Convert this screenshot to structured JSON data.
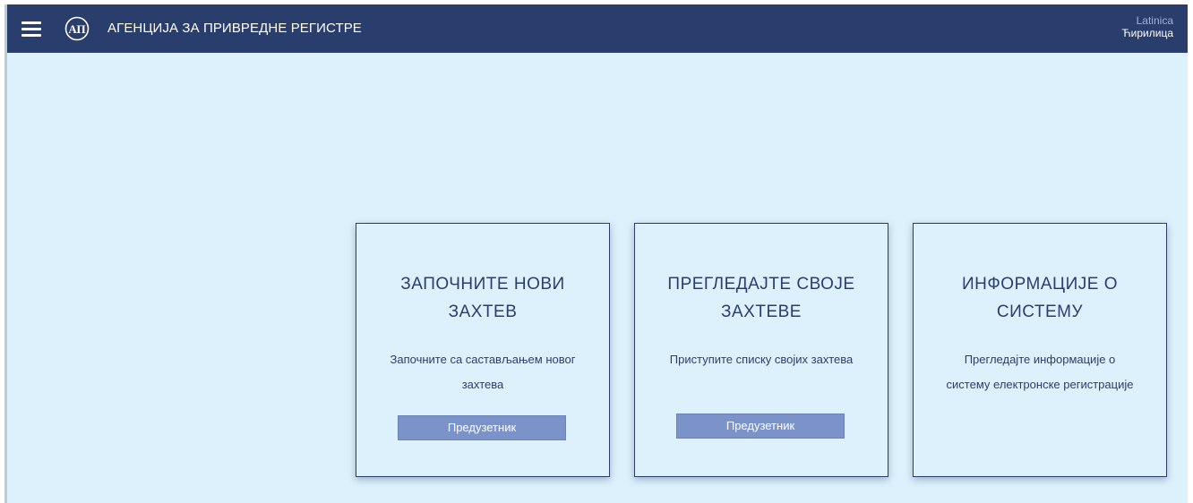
{
  "header": {
    "title": "АГЕНЦИЈА ЗА ПРИВРЕДНЕ РЕГИСТРЕ",
    "logo_icon": "apr-logo-icon",
    "menu_icon": "hamburger-menu-icon",
    "lang_latin": "Latinica",
    "lang_cyrillic": "Ћирилица"
  },
  "cards": [
    {
      "title_line1": "ЗАПОЧНИТЕ НОВИ",
      "title_line2": "ЗАХТЕВ",
      "desc_line1": "Започните са састављањем новог",
      "desc_line2": "захтева",
      "button": "Предузетник"
    },
    {
      "title_line1": "ПРЕГЛЕДАЈТЕ СВОЈЕ",
      "title_line2": "ЗАХТЕВЕ",
      "desc_line1": "Приступите списку својих захтева",
      "desc_line2": "",
      "button": "Предузетник"
    },
    {
      "title_line1": "ИНФОРМАЦИЈЕ О",
      "title_line2": "СИСТЕМУ",
      "desc_line1": "Прегледајте информације о",
      "desc_line2": "систему електронске регистрације"
    }
  ],
  "colors": {
    "header_bg": "#2a3e6d",
    "page_bg": "#dcf1fc",
    "button_bg": "#7b93c9",
    "text_primary": "#2a3e6d"
  }
}
